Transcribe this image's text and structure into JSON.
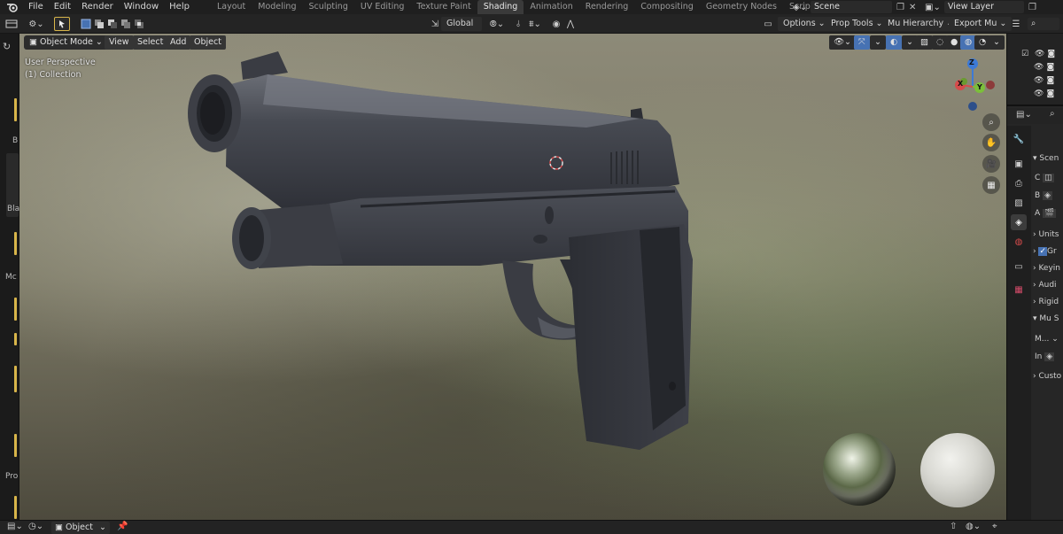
{
  "topbar": {
    "menus": [
      "File",
      "Edit",
      "Render",
      "Window",
      "Help"
    ],
    "workspaces": [
      "Layout",
      "Modeling",
      "Sculpting",
      "UV Editing",
      "Texture Paint",
      "Shading",
      "Animation",
      "Rendering",
      "Compositing",
      "Geometry Nodes",
      "Scripting"
    ],
    "active_workspace": "Shading",
    "scene": "Scene",
    "view_layer": "View Layer"
  },
  "header": {
    "transform_orientation": "Global",
    "options": "Options",
    "prop_tools": "Prop Tools",
    "mu_hierarchy": "Mu Hierarchy",
    "export_mu": "Export Mu"
  },
  "viewport": {
    "mode": "Object Mode",
    "menus": [
      "View",
      "Select",
      "Add",
      "Object"
    ],
    "view_name": "User Perspective",
    "collection": "(1) Collection",
    "gizmo_labels": {
      "x": "X",
      "y": "Y",
      "z": "Z"
    }
  },
  "left_strip": {
    "labels": [
      "B",
      "Bla",
      "Mc",
      "Pro"
    ]
  },
  "properties": {
    "rows": [
      "Scen",
      "C",
      "B",
      "A",
      "Units",
      "Gr",
      "Keyin",
      "Audi",
      "Rigid",
      "Mu S",
      "M...",
      "In",
      "Custo"
    ]
  },
  "bottombar": {
    "object_label": "Object"
  },
  "colors": {
    "accent": "#4772b3",
    "gizmo_x": "#d64b4b",
    "gizmo_y": "#7bbf3a",
    "gizmo_z": "#3d7ad6",
    "marker": "#d8b54a"
  }
}
